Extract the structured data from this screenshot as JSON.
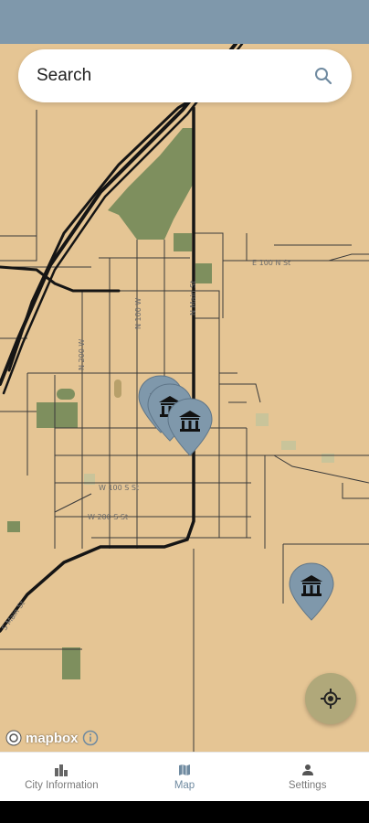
{
  "search": {
    "placeholder_label": "Search",
    "icon": "search-icon"
  },
  "map": {
    "streets": [
      "E 100 N St",
      "W 100 S St",
      "W 200 S St",
      "N 200 W",
      "N 100 W",
      "N Main St",
      "S Main St"
    ],
    "attribution": "mapbox",
    "info_icon": "info-icon",
    "museum_icon": "museum-icon",
    "colors": {
      "land": "#e5c594",
      "park": "#7e8f5e",
      "road": "#151515",
      "pin": "#7f98ab"
    }
  },
  "locate_button": {
    "icon": "crosshair-icon"
  },
  "nav": {
    "items": [
      {
        "label": "City Information",
        "icon": "city-icon"
      },
      {
        "label": "Map",
        "icon": "map-icon"
      },
      {
        "label": "Settings",
        "icon": "person-icon"
      }
    ],
    "active": "Map"
  }
}
